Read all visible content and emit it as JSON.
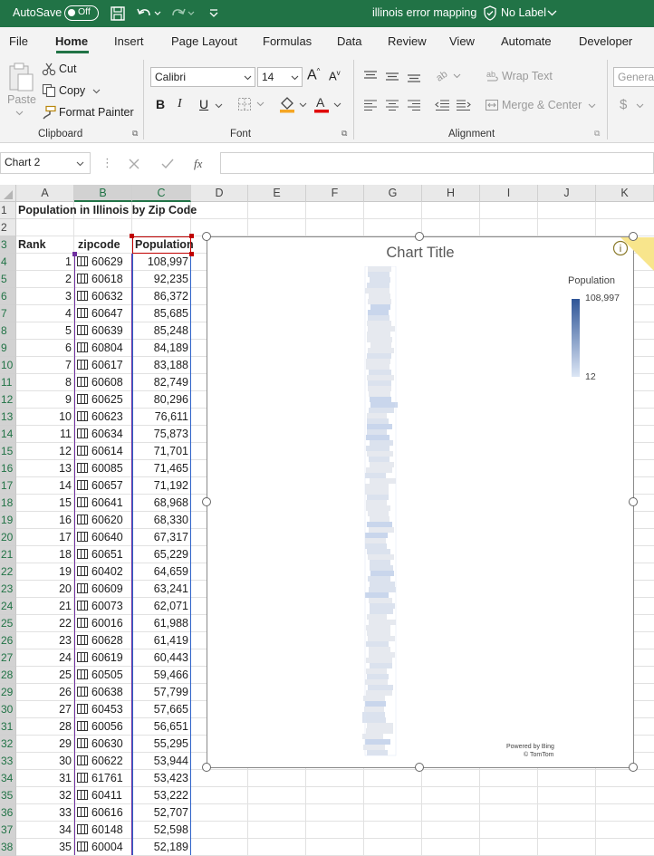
{
  "titlebar": {
    "autosave_label": "AutoSave",
    "autosave_state": "Off",
    "file_name": "illinois error mapping",
    "label_status": "No Label"
  },
  "ribbon_tabs": [
    "File",
    "Home",
    "Insert",
    "Page Layout",
    "Formulas",
    "Data",
    "Review",
    "View",
    "Automate",
    "Developer"
  ],
  "active_tab": "Home",
  "clipboard": {
    "group": "Clipboard",
    "paste": "Paste",
    "cut": "Cut",
    "copy": "Copy",
    "format_painter": "Format Painter"
  },
  "font": {
    "group": "Font",
    "name": "Calibri",
    "size": "14",
    "bold": "B",
    "italic": "I",
    "underline": "U"
  },
  "alignment": {
    "group": "Alignment",
    "wrap_text": "Wrap Text",
    "merge_center": "Merge & Center"
  },
  "number": {
    "format": "General",
    "currency": "$"
  },
  "formula_bar": {
    "name_box": "Chart 2",
    "fx": "fx",
    "formula": ""
  },
  "columns": [
    "A",
    "B",
    "C",
    "D",
    "E",
    "F",
    "G",
    "H",
    "I",
    "J",
    "K"
  ],
  "sheet": {
    "title": "Population in Illinois by Zip Code",
    "headers": {
      "rank": "Rank",
      "zipcode": "zipcode",
      "population": "Population"
    },
    "rows": [
      {
        "rank": "1",
        "zip": "60629",
        "pop": "108,997"
      },
      {
        "rank": "2",
        "zip": "60618",
        "pop": "92,235"
      },
      {
        "rank": "3",
        "zip": "60632",
        "pop": "86,372"
      },
      {
        "rank": "4",
        "zip": "60647",
        "pop": "85,685"
      },
      {
        "rank": "5",
        "zip": "60639",
        "pop": "85,248"
      },
      {
        "rank": "6",
        "zip": "60804",
        "pop": "84,189"
      },
      {
        "rank": "7",
        "zip": "60617",
        "pop": "83,188"
      },
      {
        "rank": "8",
        "zip": "60608",
        "pop": "82,749"
      },
      {
        "rank": "9",
        "zip": "60625",
        "pop": "80,296"
      },
      {
        "rank": "10",
        "zip": "60623",
        "pop": "76,611"
      },
      {
        "rank": "11",
        "zip": "60634",
        "pop": "75,873"
      },
      {
        "rank": "12",
        "zip": "60614",
        "pop": "71,701"
      },
      {
        "rank": "13",
        "zip": "60085",
        "pop": "71,465"
      },
      {
        "rank": "14",
        "zip": "60657",
        "pop": "71,192"
      },
      {
        "rank": "15",
        "zip": "60641",
        "pop": "68,968"
      },
      {
        "rank": "16",
        "zip": "60620",
        "pop": "68,330"
      },
      {
        "rank": "17",
        "zip": "60640",
        "pop": "67,317"
      },
      {
        "rank": "18",
        "zip": "60651",
        "pop": "65,229"
      },
      {
        "rank": "19",
        "zip": "60402",
        "pop": "64,659"
      },
      {
        "rank": "20",
        "zip": "60609",
        "pop": "63,241"
      },
      {
        "rank": "21",
        "zip": "60073",
        "pop": "62,071"
      },
      {
        "rank": "22",
        "zip": "60016",
        "pop": "61,988"
      },
      {
        "rank": "23",
        "zip": "60628",
        "pop": "61,419"
      },
      {
        "rank": "24",
        "zip": "60619",
        "pop": "60,443"
      },
      {
        "rank": "25",
        "zip": "60505",
        "pop": "59,466"
      },
      {
        "rank": "26",
        "zip": "60638",
        "pop": "57,799"
      },
      {
        "rank": "27",
        "zip": "60453",
        "pop": "57,665"
      },
      {
        "rank": "28",
        "zip": "60056",
        "pop": "56,651"
      },
      {
        "rank": "29",
        "zip": "60630",
        "pop": "55,295"
      },
      {
        "rank": "30",
        "zip": "60622",
        "pop": "53,944"
      },
      {
        "rank": "31",
        "zip": "61761",
        "pop": "53,423"
      },
      {
        "rank": "32",
        "zip": "60411",
        "pop": "53,222"
      },
      {
        "rank": "33",
        "zip": "60616",
        "pop": "52,707"
      },
      {
        "rank": "34",
        "zip": "60148",
        "pop": "52,598"
      },
      {
        "rank": "35",
        "zip": "60004",
        "pop": "52,189"
      }
    ]
  },
  "chart": {
    "title": "Chart Title",
    "legend_title": "Population",
    "legend_max": "108,997",
    "legend_min": "12",
    "powered_by": "Powered by Bing",
    "copyright": "© TomTom",
    "info_glyph": "i",
    "color_low": "#dce6f5",
    "color_high": "#2f5597"
  }
}
